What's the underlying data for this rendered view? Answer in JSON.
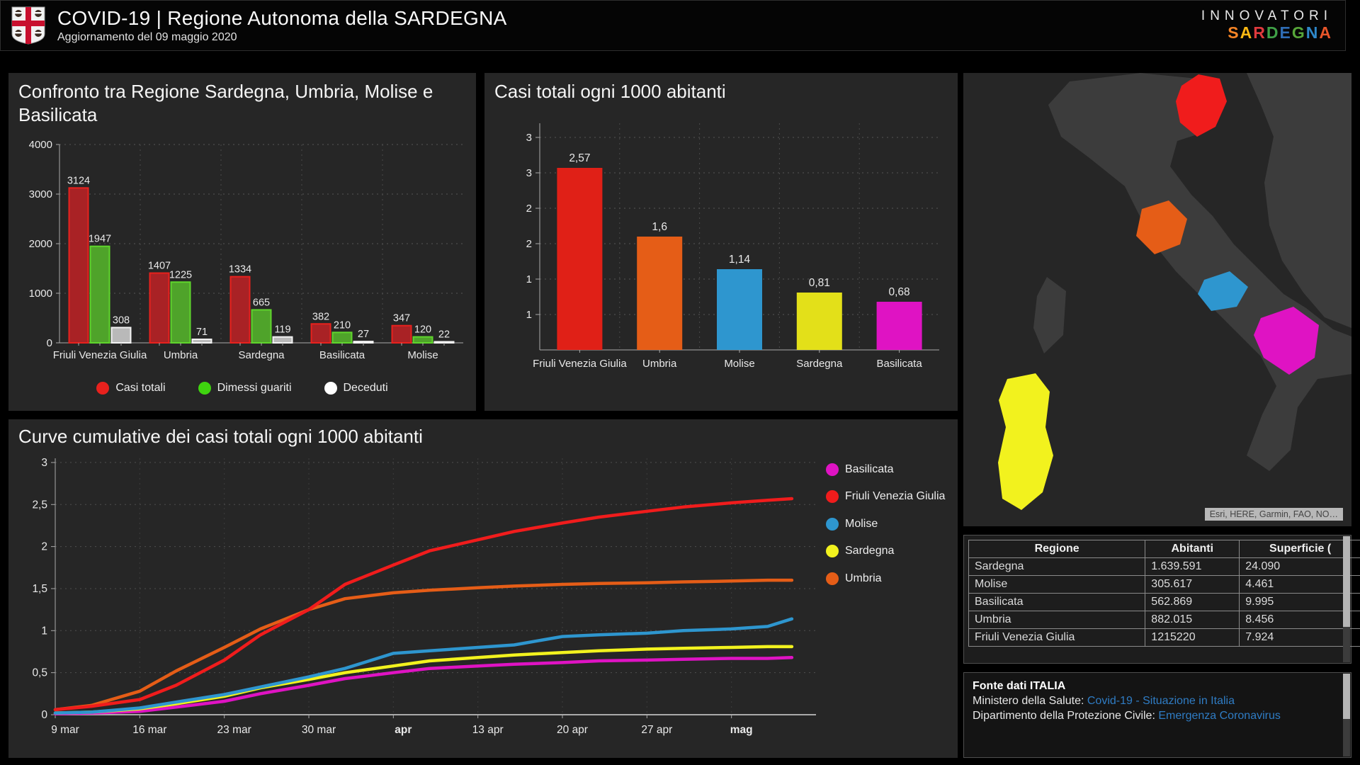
{
  "header": {
    "title": "COVID-19 | Regione Autonoma della SARDEGNA",
    "subtitle": "Aggiornamento del 09 maggio 2020",
    "logo": "stemma-sardegna (white shield, red cross, four moors' heads)",
    "brand_line1": "INNOVATORI",
    "brand_line2": "SARDEGNA",
    "brand_letters": [
      {
        "ch": "S",
        "color": "#f58426"
      },
      {
        "ch": "A",
        "color": "#fdb913"
      },
      {
        "ch": "R",
        "color": "#e03a3e"
      },
      {
        "ch": "D",
        "color": "#3fa046"
      },
      {
        "ch": "E",
        "color": "#2f6db5"
      },
      {
        "ch": "G",
        "color": "#57a639"
      },
      {
        "ch": "N",
        "color": "#2e87c8"
      },
      {
        "ch": "A",
        "color": "#e8552a"
      }
    ]
  },
  "colors": {
    "panel_bg": "#262626",
    "page_bg": "#000000",
    "casi_totali_fill": "#a92225",
    "casi_totali_stroke": "#e8211d",
    "guariti_fill": "#4fa32a",
    "guariti_stroke": "#5fd52c",
    "deceduti_fill": "#b9b9b9",
    "deceduti_stroke": "#f2f2f2",
    "fvg": "#e02017",
    "umbria": "#e55d17",
    "molise": "#2e96cf",
    "sardegna": "#e3e019",
    "basilicata": "#df13c3",
    "link_blue": "#2f7cc4"
  },
  "chart_data": [
    {
      "id": "confronto",
      "type": "bar",
      "title": "Confronto tra Regione Sardegna, Umbria, Molise e Basilicata",
      "categories": [
        "Friuli Venezia Giulia",
        "Umbria",
        "Sardegna",
        "Basilicata",
        "Molise"
      ],
      "series": [
        {
          "name": "Casi totali",
          "fill": "#a92225",
          "stroke": "#e8211d",
          "values": [
            3124,
            1407,
            1334,
            382,
            347
          ]
        },
        {
          "name": "Dimessi guariti",
          "fill": "#4fa32a",
          "stroke": "#5fd52c",
          "values": [
            1947,
            1225,
            665,
            210,
            120
          ]
        },
        {
          "name": "Deceduti",
          "fill": "#b9b9b9",
          "stroke": "#f2f2f2",
          "values": [
            308,
            71,
            119,
            27,
            22
          ]
        }
      ],
      "legend": [
        {
          "label": "Casi totali",
          "color": "#e8211d"
        },
        {
          "label": "Dimessi guariti",
          "color": "#3fd40f"
        },
        {
          "label": "Deceduti",
          "color": "#ffffff"
        }
      ],
      "ylim": [
        0,
        4000
      ],
      "yticks": [
        0,
        1000,
        2000,
        3000,
        4000
      ],
      "ytick_labels": [
        "0",
        "1000",
        "2000",
        "3000",
        "4000"
      ],
      "grid": "dashed"
    },
    {
      "id": "per1000",
      "type": "bar",
      "title": "Casi totali ogni 1000 abitanti",
      "categories": [
        "Friuli Venezia Giulia",
        "Umbria",
        "Molise",
        "Sardegna",
        "Basilicata"
      ],
      "values": [
        2.57,
        1.6,
        1.14,
        0.81,
        0.68
      ],
      "value_labels": [
        "2,57",
        "1,6",
        "1,14",
        "0,81",
        "0,68"
      ],
      "bar_colors": [
        "#e02017",
        "#e55d17",
        "#2e96cf",
        "#e3e019",
        "#df13c3"
      ],
      "ylim": [
        0,
        3.2
      ],
      "yticks": [
        3,
        2.5,
        2,
        1.5,
        1,
        0.5
      ],
      "ytick_labels": [
        "3",
        "3",
        "2",
        "2",
        "1",
        "1"
      ],
      "grid": "dashed"
    },
    {
      "id": "curve",
      "type": "line",
      "title": "Curve cumulative dei casi totali ogni 1000 abitanti",
      "x_days": [
        0,
        3,
        7,
        10,
        14,
        17,
        21,
        24,
        28,
        31,
        35,
        38,
        42,
        45,
        49,
        52,
        56,
        59,
        61
      ],
      "xlim": [
        0,
        63
      ],
      "xticks": [
        {
          "day": 0,
          "label": "9 mar",
          "bold": false
        },
        {
          "day": 7,
          "label": "16 mar",
          "bold": false
        },
        {
          "day": 14,
          "label": "23 mar",
          "bold": false
        },
        {
          "day": 21,
          "label": "30 mar",
          "bold": false
        },
        {
          "day": 28,
          "label": "apr",
          "bold": true
        },
        {
          "day": 35,
          "label": "13 apr",
          "bold": false
        },
        {
          "day": 42,
          "label": "20 apr",
          "bold": false
        },
        {
          "day": 49,
          "label": "27 apr",
          "bold": false
        },
        {
          "day": 56,
          "label": "mag",
          "bold": true
        }
      ],
      "ylim": [
        0,
        3.05
      ],
      "yticks": [
        3,
        2.5,
        2,
        1.5,
        1,
        0.5,
        0
      ],
      "ytick_labels": [
        "3",
        "2,5",
        "2",
        "1,5",
        "1",
        "0,5",
        "0"
      ],
      "series": [
        {
          "name": "Basilicata",
          "color": "#df13c3",
          "values": [
            0.01,
            0.02,
            0.04,
            0.09,
            0.16,
            0.25,
            0.35,
            0.43,
            0.5,
            0.55,
            0.58,
            0.6,
            0.62,
            0.64,
            0.65,
            0.66,
            0.67,
            0.67,
            0.68
          ]
        },
        {
          "name": "Sardegna",
          "color": "#f2f21e",
          "values": [
            0.02,
            0.03,
            0.07,
            0.13,
            0.22,
            0.32,
            0.42,
            0.5,
            0.58,
            0.64,
            0.68,
            0.71,
            0.74,
            0.76,
            0.78,
            0.79,
            0.8,
            0.81,
            0.81
          ]
        },
        {
          "name": "Molise",
          "color": "#2e96cf",
          "values": [
            0.02,
            0.03,
            0.08,
            0.15,
            0.24,
            0.33,
            0.45,
            0.55,
            0.73,
            0.76,
            0.8,
            0.83,
            0.93,
            0.95,
            0.97,
            1.0,
            1.02,
            1.05,
            1.14
          ]
        },
        {
          "name": "Umbria",
          "color": "#e55d17",
          "values": [
            0.06,
            0.11,
            0.28,
            0.52,
            0.8,
            1.02,
            1.25,
            1.38,
            1.45,
            1.48,
            1.51,
            1.53,
            1.55,
            1.56,
            1.57,
            1.58,
            1.59,
            1.6,
            1.6
          ]
        },
        {
          "name": "Friuli Venezia Giulia",
          "color": "#f01c1c",
          "values": [
            0.06,
            0.1,
            0.18,
            0.35,
            0.65,
            0.95,
            1.25,
            1.55,
            1.78,
            1.95,
            2.08,
            2.18,
            2.28,
            2.35,
            2.42,
            2.47,
            2.52,
            2.55,
            2.57
          ]
        }
      ],
      "legend_order": [
        {
          "label": "Basilicata",
          "color": "#df13c3"
        },
        {
          "label": "Friuli Venezia Giulia",
          "color": "#f01c1c"
        },
        {
          "label": "Molise",
          "color": "#2e96cf"
        },
        {
          "label": "Sardegna",
          "color": "#f2f21e"
        },
        {
          "label": "Umbria",
          "color": "#e55d17"
        }
      ],
      "grid": "dashed"
    }
  ],
  "map": {
    "attribution": "Esri, HERE, Garmin, FAO, NO…",
    "regions": [
      {
        "name": "Friuli Venezia Giulia",
        "color": "#f01c1c"
      },
      {
        "name": "Umbria",
        "color": "#e55d17"
      },
      {
        "name": "Molise",
        "color": "#2e96cf"
      },
      {
        "name": "Sardegna",
        "color": "#f2f21e"
      },
      {
        "name": "Basilicata",
        "color": "#df13c3"
      }
    ]
  },
  "table": {
    "headers": [
      "Regione",
      "Abitanti",
      "Superficie ("
    ],
    "rows": [
      [
        "Sardegna",
        "1.639.591",
        "24.090"
      ],
      [
        "Molise",
        "305.617",
        "4.461"
      ],
      [
        "Basilicata",
        "562.869",
        "9.995"
      ],
      [
        "Umbria",
        "882.015",
        "8.456"
      ],
      [
        "Friuli Venezia Giulia",
        "1215220",
        "7.924"
      ]
    ]
  },
  "fonte": {
    "title": "Fonte dati ITALIA",
    "lines": [
      {
        "label": "Ministero della Salute: ",
        "link": "Covid-19 - Situazione in Italia"
      },
      {
        "label": "Dipartimento della Protezione Civile: ",
        "link": "Emergenza Coronavirus"
      }
    ]
  }
}
